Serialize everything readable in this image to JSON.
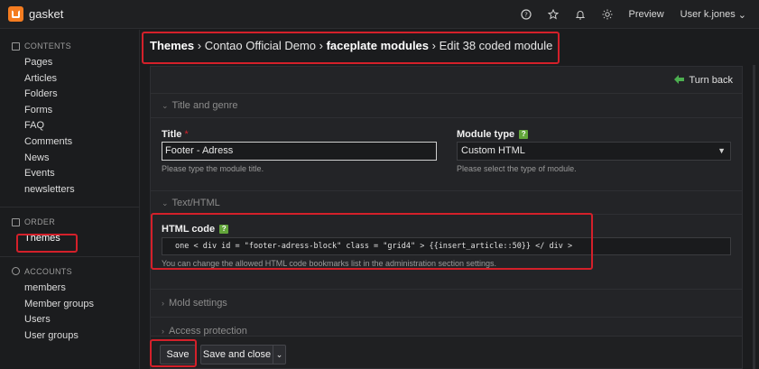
{
  "app": {
    "name": "gasket"
  },
  "topbar": {
    "icons": [
      "help-icon",
      "star-icon",
      "bell-icon",
      "sun-icon"
    ],
    "preview_label": "Preview",
    "user_label": "User k.jones",
    "user_caret": "⌄"
  },
  "sidebar": {
    "contents": {
      "title": "CONTENTS",
      "items": [
        "Pages",
        "Articles",
        "Folders",
        "Forms",
        "FAQ",
        "Comments",
        "News",
        "Events",
        "newsletters"
      ]
    },
    "order": {
      "title": "ORDER",
      "items": [
        "Themes"
      ]
    },
    "accounts": {
      "title": "ACCOUNTS",
      "items": [
        "members",
        "Member groups",
        "Users",
        "User groups"
      ]
    }
  },
  "breadcrumb": {
    "part1": "Themes",
    "sep1": " › ",
    "part2": "Contao Official Demo",
    "sep2": " › ",
    "part3": "faceplate modules",
    "sep3": " › ",
    "part4": "Edit 38 coded module"
  },
  "panel": {
    "turn_back_label": "Turn back",
    "section_title_genre": "Title and genre",
    "title_field": {
      "label": "Title",
      "required_mark": "*",
      "value": "Footer - Adress",
      "hint": "Please type the module title."
    },
    "module_type": {
      "label": "Module type",
      "help": "?",
      "value": "Custom HTML",
      "hint": "Please select the type of module."
    },
    "section_html": "Text/HTML",
    "html_code": {
      "label": "HTML code",
      "help": "?",
      "value": "one < div id = \"footer-adress-block\" class = \"grid4\" > {{insert_article::50}} </ div >",
      "hint": "You can change the allowed HTML code bookmarks list in the administration section settings."
    },
    "section_mold": "Mold settings",
    "section_access": "Access protection"
  },
  "footer": {
    "save_label": "Save",
    "save_close_label": "Save and close",
    "dropdown_caret": "⌄"
  },
  "colors": {
    "accent": "#f47c20",
    "highlight": "#d4202a",
    "help": "#62a53a"
  }
}
